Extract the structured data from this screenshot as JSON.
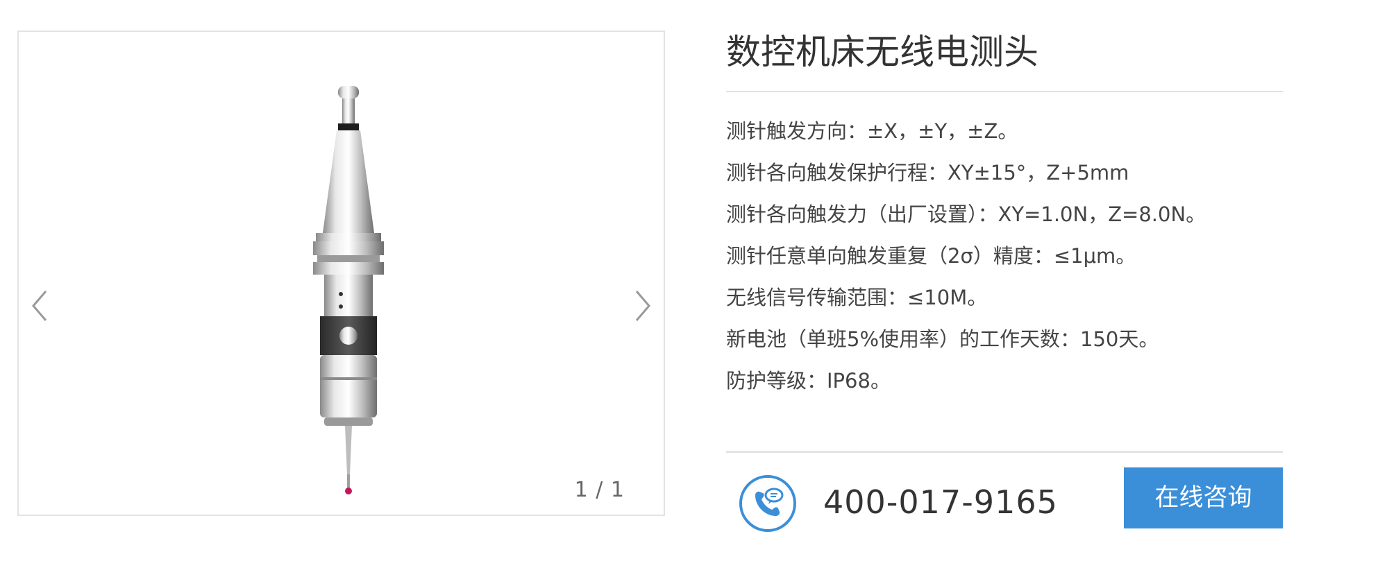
{
  "gallery": {
    "prev_icon": "chevron-left-icon",
    "next_icon": "chevron-right-icon",
    "pager": "1 / 1",
    "product_image": "cnc-wireless-probe"
  },
  "product": {
    "title": "数控机床无线电测头",
    "specs": [
      "测针触发方向：±X，±Y，±Z。",
      "测针各向触发保护行程：XY±15°，Z+5mm",
      "测针各向触发力（出厂设置）：XY=1.0N，Z=8.0N。",
      "测针任意单向触发重复（2σ）精度：≤1μm。",
      "无线信号传输范围：≤10M。",
      "新电池（单班5%使用率）的工作天数：150天。",
      "防护等级：IP68。"
    ]
  },
  "contact": {
    "phone_icon": "phone-chat-icon",
    "phone_number": "400-017-9165",
    "consult_label": "在线咨询"
  },
  "colors": {
    "accent": "#3b8fd9",
    "border": "#e3e3e3",
    "text": "#333333"
  }
}
